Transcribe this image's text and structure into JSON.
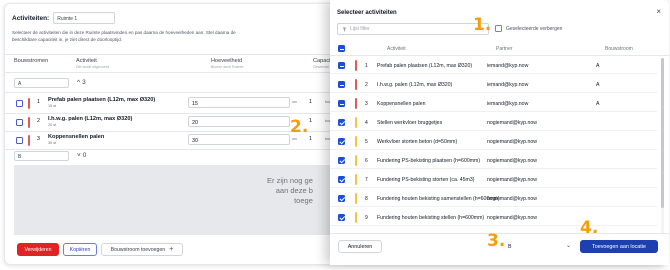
{
  "left": {
    "activiteiten_label": "Activiteiten:",
    "ruimte_value": "Ruimte 1",
    "description": "Selecteer de activiteiten die in deze Ruimte plaatsvinden en pas daarna de hoeveelheden aan. Stel daarna de beschikbare capaciteit in, je ziet direct de doorlooptijd.",
    "headers": {
      "bouwstromen": "Bouwstromen",
      "activiteit": "Activiteit",
      "activiteit_sub": "Die wordt uitgevoerd",
      "hoeveelheid": "Hoeveelheid",
      "hoeveelheid_sub": "Binnen deze Ruimte",
      "capaciteit": "Capacite",
      "capaciteit_sub": "Gewenste"
    },
    "group_a": {
      "select_value": "A",
      "count": "3"
    },
    "group_b": {
      "select_value": "B",
      "count": "0"
    },
    "rows": [
      {
        "num": "1",
        "name": "Prefab palen plaatsen (L12m, max Ø320)",
        "sub": "15 st",
        "qty": "15",
        "unit": "um",
        "extra": "1",
        "extra2": "bue",
        "color": "#e05a5a"
      },
      {
        "num": "2",
        "name": "I.h.w.g. palen (L12m, max Ø320)",
        "sub": "20 st",
        "qty": "20",
        "unit": "um",
        "extra": "1",
        "extra2": "bue",
        "color": "#e05a5a"
      },
      {
        "num": "3",
        "name": "Koppensnellen palen",
        "sub": "30 st",
        "qty": "30",
        "unit": "um",
        "extra": "1",
        "extra2": "bue",
        "color": "#e05a5a"
      }
    ],
    "empty_message": [
      "Er zijn nog ge",
      "aan deze b",
      "toege"
    ],
    "buttons": {
      "verwijderen": "Verwijderen",
      "kopieren": "Kopiëren",
      "bouwstroom_toevoegen": "Bouwstroom toevoegen",
      "plus": "+"
    }
  },
  "modal": {
    "title": "Selecteer activiteiten",
    "close": "×",
    "filter_placeholder": "Lijst filter",
    "hide_selected_label": "Geselecteerde verbergen",
    "columns": {
      "activiteit": "Activiteit",
      "partner": "Partner",
      "bouwstroom": "Bouwstroom"
    },
    "rows": [
      {
        "num": "1",
        "name": "Prefab palen plaatsen (L12m, max Ø320)",
        "partner": "iemand@kyp.now",
        "bouwstroom": "A",
        "state": "dash",
        "color": "#e05a5a"
      },
      {
        "num": "2",
        "name": "I.h.w.g. palen (L12m, max Ø320)",
        "partner": "iemand@kyp.now",
        "bouwstroom": "A",
        "state": "dash",
        "color": "#e05a5a"
      },
      {
        "num": "3",
        "name": "Koppensnellen palen",
        "partner": "iemand@kyp.now",
        "bouwstroom": "A",
        "state": "dash",
        "color": "#e05a5a"
      },
      {
        "num": "4",
        "name": "Stellen werkvloer bruggetjes",
        "partner": "nogiemand@kyp.now",
        "bouwstroom": "",
        "state": "checked",
        "color": "#f4c542"
      },
      {
        "num": "5",
        "name": "Werkvloer storten beton (d=50mm)",
        "partner": "nogiemand@kyp.now",
        "bouwstroom": "",
        "state": "checked",
        "color": "#f4c542"
      },
      {
        "num": "6",
        "name": "Fundering PS-bekisting plaatsen (h=600mm)",
        "partner": "nogiemand@kyp.now",
        "bouwstroom": "",
        "state": "checked",
        "color": "#f4c542"
      },
      {
        "num": "7",
        "name": "Fundering PS-bekisting storten (ca. 45m3)",
        "partner": "nogiemand@kyp.now",
        "bouwstroom": "",
        "state": "checked",
        "color": "#f4c542"
      },
      {
        "num": "8",
        "name": "Fundering houten bekisting samenstellen (h=600mm)",
        "partner": "nogiemand@kyp.now",
        "bouwstroom": "",
        "state": "checked",
        "color": "#f4c542"
      },
      {
        "num": "9",
        "name": "Fundering houten bekisting stellen (h=600mm)",
        "partner": "nogiemand@kyp.now",
        "bouwstroom": "",
        "state": "checked",
        "color": "#f4c542"
      }
    ],
    "footer": {
      "annuleren": "Annuleren",
      "count": "B",
      "add": "Toevoegen aan locatie"
    }
  },
  "annotations": [
    "1.",
    "2.",
    "3.",
    "4."
  ]
}
